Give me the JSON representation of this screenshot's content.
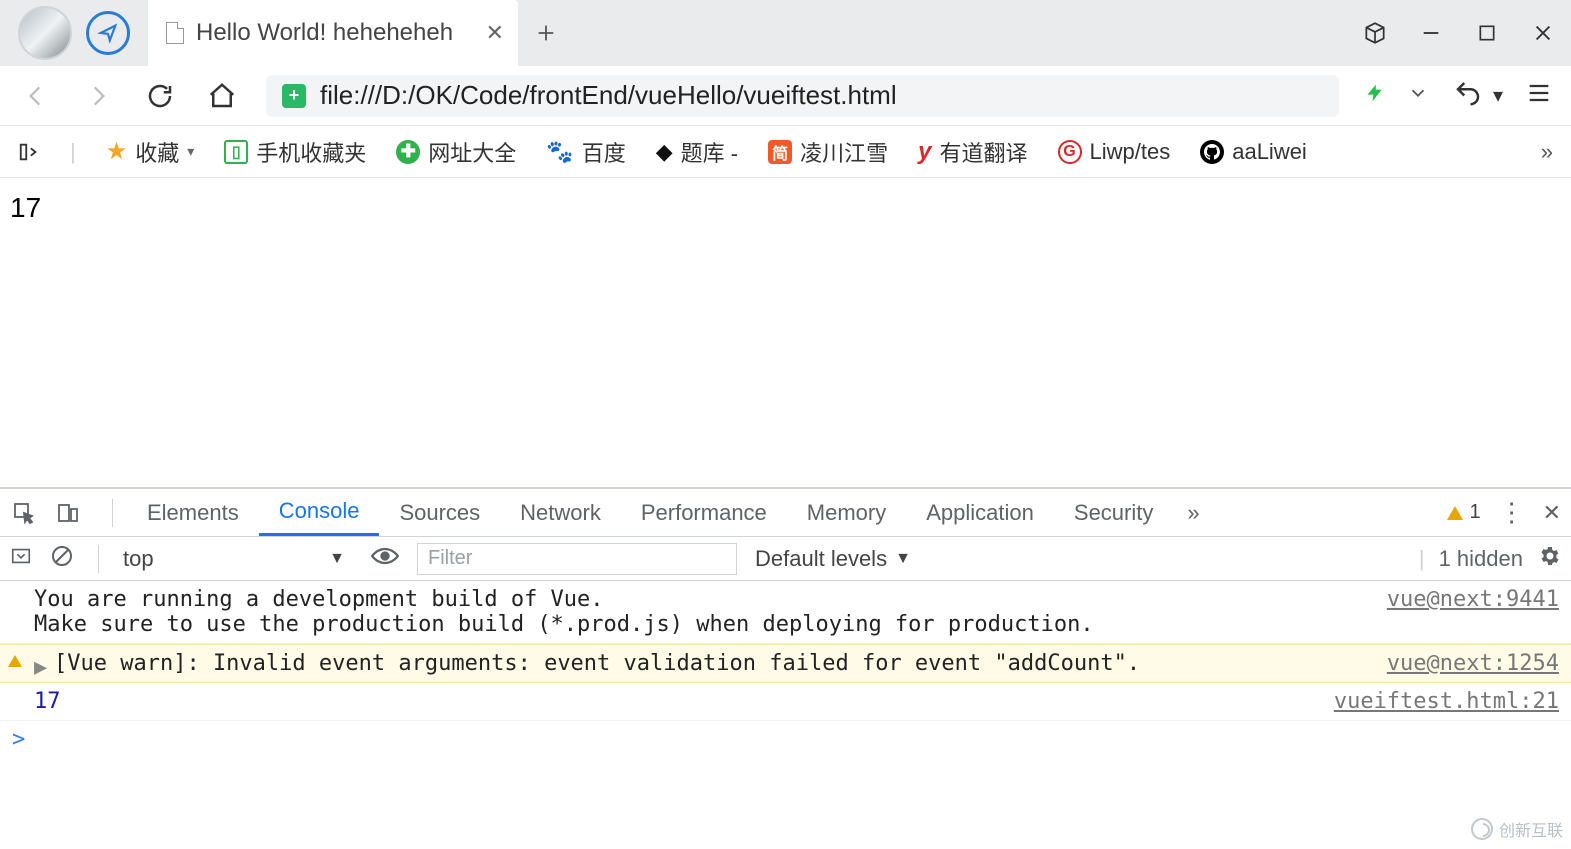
{
  "tab": {
    "title": "Hello World! heheheheh"
  },
  "url": "file:///D:/OK/Code/frontEnd/vueHello/vueiftest.html",
  "bookmarks": {
    "fav": {
      "label": "收藏"
    },
    "mobile": {
      "label": "手机收藏夹"
    },
    "all": {
      "label": "网址大全"
    },
    "baidu": {
      "label": "百度"
    },
    "tiku": {
      "label": "题库 -"
    },
    "ling": {
      "label": "凌川江雪"
    },
    "youdao": {
      "label": "有道翻译"
    },
    "liwp": {
      "label": "Liwp/tes"
    },
    "aaliwei": {
      "label": "aaLiwei"
    }
  },
  "page": {
    "content": "17"
  },
  "devtools": {
    "tabs": {
      "elements": "Elements",
      "console": "Console",
      "sources": "Sources",
      "network": "Network",
      "performance": "Performance",
      "memory": "Memory",
      "application": "Application",
      "security": "Security"
    },
    "warn_count": "1",
    "context": "top",
    "filter_placeholder": "Filter",
    "levels": "Default levels",
    "hidden": "1 hidden",
    "rows": {
      "info_msg": "You are running a development build of Vue.\nMake sure to use the production build (*.prod.js) when deploying for production.",
      "info_src": "vue@next:9441",
      "warn_msg": "[Vue warn]: Invalid event arguments: event validation failed for event \"addCount\".",
      "warn_src": "vue@next:1254",
      "log_msg": "17",
      "log_src": "vueiftest.html:21"
    },
    "prompt": ">"
  },
  "watermark": "创新互联"
}
